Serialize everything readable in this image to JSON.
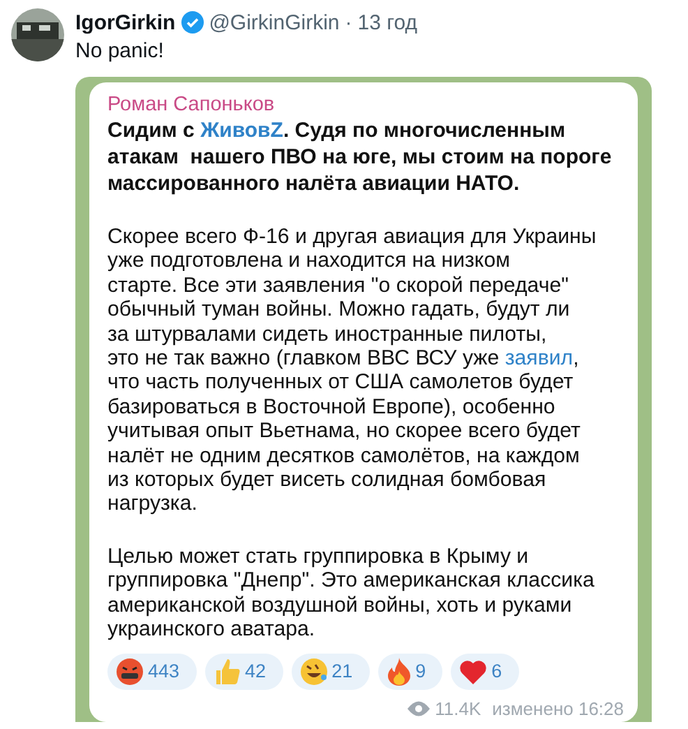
{
  "tweet": {
    "display_name": "IgorGirkin",
    "verified": true,
    "handle": "@GirkinGirkin",
    "separator": "·",
    "time": "13 год",
    "text": "No panic!"
  },
  "post": {
    "author": "Роман Сапоньков",
    "paragraphs": [
      {
        "bold": true,
        "lines": [
          [
            {
              "kind": "plain",
              "text": "Сидим с "
            },
            {
              "kind": "link",
              "text": "ЖивовZ"
            },
            {
              "kind": "plain",
              "text": ". Судя по многочисленным"
            }
          ],
          [
            {
              "kind": "plain",
              "text": "атакам  нашего ПВО на юге, мы стоим на пороге"
            }
          ],
          [
            {
              "kind": "plain",
              "text": "массированного налёта авиации НАТО."
            }
          ]
        ]
      },
      {
        "bold": false,
        "lines": [
          [
            {
              "kind": "plain",
              "text": "Скорее всего Ф-16 и другая авиация для Украины"
            }
          ],
          [
            {
              "kind": "plain",
              "text": "уже подготовлена и находится на низком"
            }
          ],
          [
            {
              "kind": "plain",
              "text": "старте. Все эти заявления \"о скорой передаче\""
            }
          ],
          [
            {
              "kind": "plain",
              "text": "обычный туман войны. Можно гадать, будут ли"
            }
          ],
          [
            {
              "kind": "plain",
              "text": "за штурвалами сидеть иностранные пилоты,"
            }
          ],
          [
            {
              "kind": "plain",
              "text": "это не так важно (главком ВВС ВСУ уже "
            },
            {
              "kind": "link",
              "text": "заявил"
            },
            {
              "kind": "plain",
              "text": ","
            }
          ],
          [
            {
              "kind": "plain",
              "text": "что часть полученных от США самолетов будет"
            }
          ],
          [
            {
              "kind": "plain",
              "text": "базироваться в Восточной Европе), особенно"
            }
          ],
          [
            {
              "kind": "plain",
              "text": "учитывая опыт Вьетнама, но скорее всего будет"
            }
          ],
          [
            {
              "kind": "plain",
              "text": "налёт не одним десятков самолётов, на каждом"
            }
          ],
          [
            {
              "kind": "plain",
              "text": "из которых будет висеть солидная бомбовая"
            }
          ],
          [
            {
              "kind": "plain",
              "text": "нагрузка."
            }
          ]
        ]
      },
      {
        "bold": false,
        "lines": [
          [
            {
              "kind": "plain",
              "text": "Целью может стать группировка в Крыму и"
            }
          ],
          [
            {
              "kind": "plain",
              "text": "группировка \"Днепр\". Это американская классика"
            }
          ],
          [
            {
              "kind": "plain",
              "text": "американской воздушной войны, хоть и руками"
            }
          ],
          [
            {
              "kind": "plain",
              "text": "украинского аватара."
            }
          ]
        ]
      }
    ],
    "reactions": [
      {
        "kind": "angry",
        "count": "443"
      },
      {
        "kind": "thumbs",
        "count": "42"
      },
      {
        "kind": "laugh",
        "count": "21"
      },
      {
        "kind": "fire",
        "count": "9"
      },
      {
        "kind": "heart",
        "count": "6"
      }
    ],
    "views": "11.4K",
    "edited": "изменено 16:28"
  }
}
